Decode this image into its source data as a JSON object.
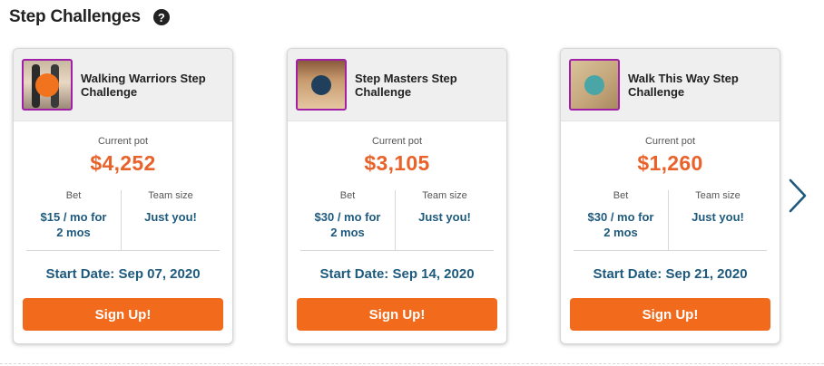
{
  "section": {
    "title": "Step Challenges",
    "help_icon": "question-circle-icon"
  },
  "colors": {
    "accent_orange": "#f26b1d",
    "pot_orange": "#e8622a",
    "value_blue": "#1e5a7d",
    "thumb_border": "#a020a8"
  },
  "cards": [
    {
      "title": "Walking Warriors Step Challenge",
      "pot_label": "Current pot",
      "pot": "$4,252",
      "bet_label": "Bet",
      "bet": "$15 / mo for 2 mos",
      "team_label": "Team size",
      "team": "Just you!",
      "start_date": "Start Date: Sep 07, 2020",
      "signup_label": "Sign Up!"
    },
    {
      "title": "Step Masters Step Challenge",
      "pot_label": "Current pot",
      "pot": "$3,105",
      "bet_label": "Bet",
      "bet": "$30 / mo for 2 mos",
      "team_label": "Team size",
      "team": "Just you!",
      "start_date": "Start Date: Sep 14, 2020",
      "signup_label": "Sign Up!"
    },
    {
      "title": "Walk This Way Step Challenge",
      "pot_label": "Current pot",
      "pot": "$1,260",
      "bet_label": "Bet",
      "bet": "$30 / mo for 2 mos",
      "team_label": "Team size",
      "team": "Just you!",
      "start_date": "Start Date: Sep 21, 2020",
      "signup_label": "Sign Up!"
    }
  ],
  "carousel": {
    "next_icon": "chevron-right-icon"
  }
}
